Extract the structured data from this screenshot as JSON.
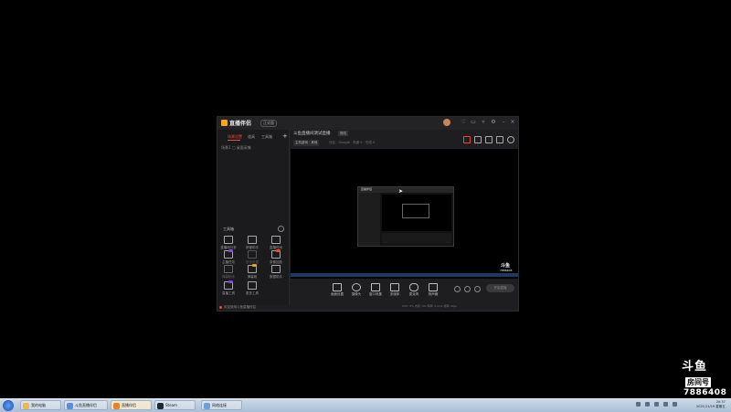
{
  "app": {
    "title": "直播伴侣",
    "version": "正式版",
    "sidebar_tabs": [
      "场景设置",
      "道具",
      "工具箱"
    ],
    "scene_row": "场景1 □ 桌面采集",
    "tools_title": "工具箱",
    "tools": [
      {
        "label": "直播间分析",
        "tag": false
      },
      {
        "label": "房管助手",
        "tag": false
      },
      {
        "label": "直播时间",
        "tag": false
      },
      {
        "label": "主播任务",
        "tag": true
      },
      {
        "label": "推流设置",
        "tag": false
      },
      {
        "label": "录像回放",
        "tag": true
      },
      {
        "label": "弹幕助手",
        "tag": false
      },
      {
        "label": "弹幕姬",
        "tag": false
      },
      {
        "label": "数据助手",
        "tag": false
      },
      {
        "label": "直播工具",
        "tag": true
      },
      {
        "label": "更多工具",
        "tag": false
      }
    ],
    "footer": "欢迎使用斗鱼直播伴侣",
    "room_title": "斗鱼直播间测试直播",
    "edit_label": "修改",
    "category": "主机游戏 · 其他",
    "room_meta": "分区：Google · 热度 0 · 在线 0",
    "preview_watermark": "斗鱼",
    "preview_watermark_num": "7886408",
    "inner_title": "直播伴侣",
    "controls": [
      "画面设置",
      "摄像头",
      "窗口采集",
      "多媒体",
      "麦克风",
      "扬声器"
    ],
    "start_live": "开始直播",
    "status": "CPU: 0%  内存: 0%  码率: 0 kb/s  帧率: 0fps"
  },
  "watermark": {
    "brand": "斗鱼",
    "room_label": "房间号",
    "room_number": "7886408"
  },
  "taskbar": {
    "tasks": [
      {
        "label": "我的电脑",
        "color": "#f0b84a",
        "active": false
      },
      {
        "label": "斗鱼直播伴侣",
        "color": "#5a8de0",
        "active": false
      },
      {
        "label": "直播伴侣",
        "color": "#e8832c",
        "active": true
      },
      {
        "label": "Steam",
        "color": "#1b2838",
        "active": false
      },
      {
        "label": "网络连接",
        "color": "#6ca0d8",
        "active": false
      }
    ],
    "clock_time": "20:37",
    "clock_date": "2021/11/19 星期五"
  },
  "colors": {
    "accent": "#e94b3c",
    "logo": "#f4a623"
  }
}
